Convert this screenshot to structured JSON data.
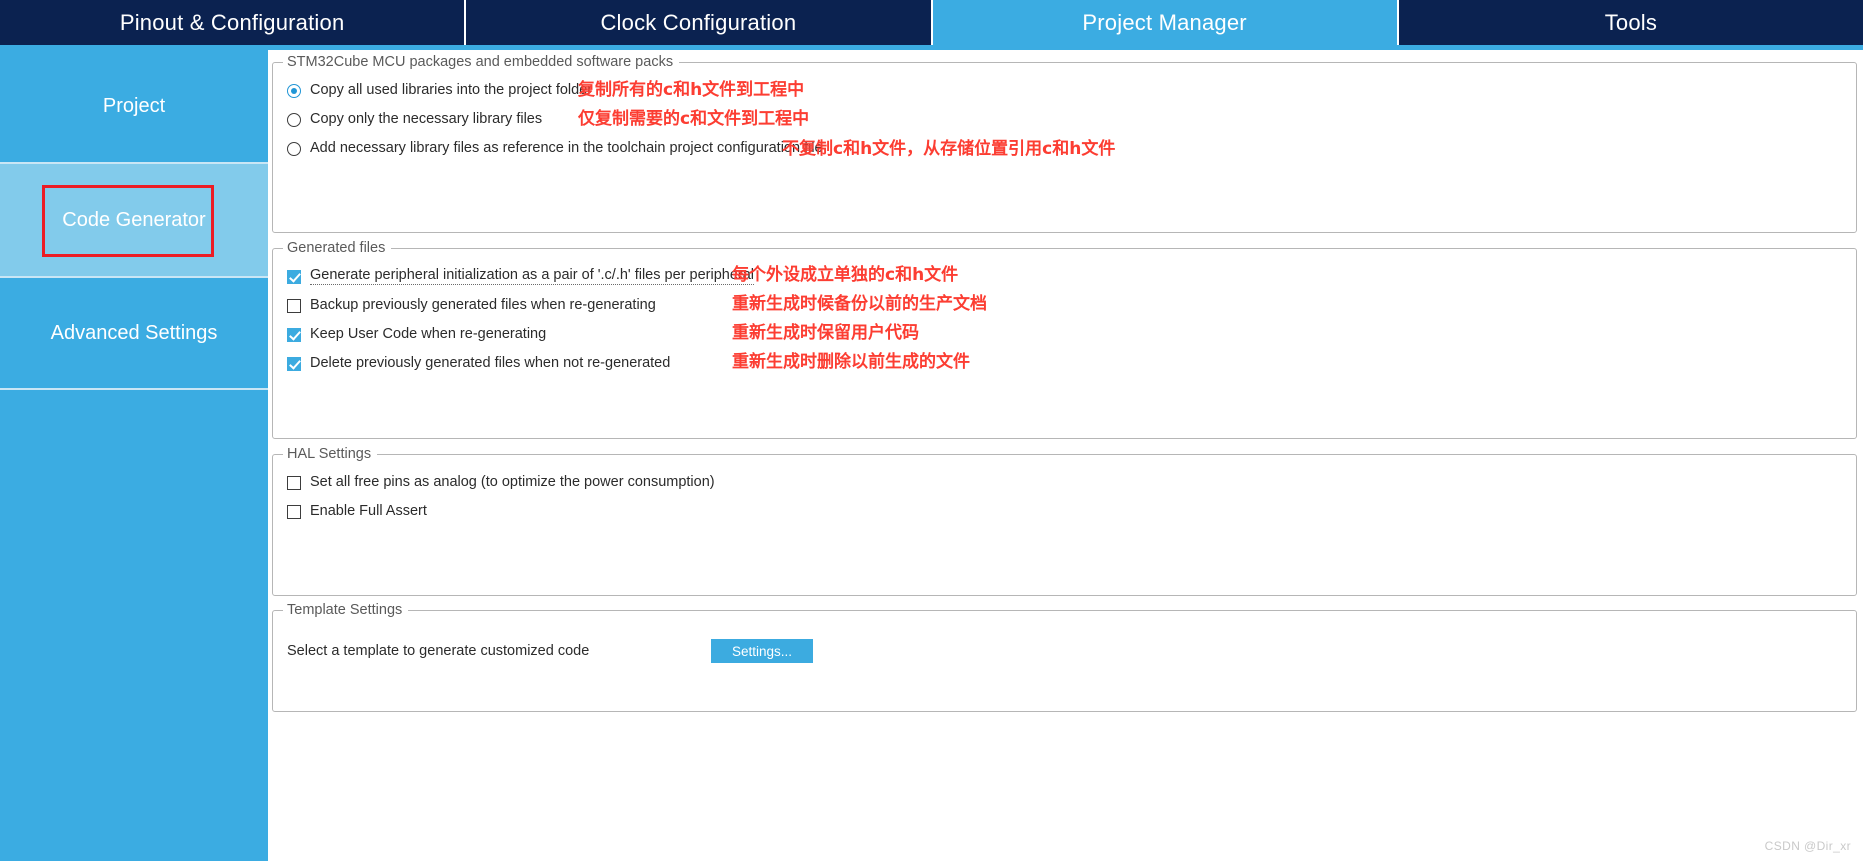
{
  "tabs": [
    {
      "label": "Pinout & Configuration",
      "active": false
    },
    {
      "label": "Clock Configuration",
      "active": false
    },
    {
      "label": "Project Manager",
      "active": true
    },
    {
      "label": "Tools",
      "active": false
    }
  ],
  "sidebar": {
    "items": [
      {
        "label": "Project"
      },
      {
        "label": "Code Generator"
      },
      {
        "label": "Advanced Settings"
      }
    ]
  },
  "groups": {
    "packages": {
      "title": "STM32Cube MCU packages and embedded software packs",
      "options": [
        {
          "label": "Copy all used libraries into the project folder",
          "selected": true,
          "annotation": "复制所有的c和h文件到工程中"
        },
        {
          "label": "Copy only the necessary library files",
          "selected": false,
          "annotation": "仅复制需要的c和文件到工程中"
        },
        {
          "label": "Add necessary library files as reference in the toolchain project configuration file",
          "selected": false,
          "annotation": "不复制c和h文件，从存储位置引用c和h文件"
        }
      ]
    },
    "generated": {
      "title": "Generated files",
      "options": [
        {
          "label": "Generate peripheral initialization as a pair of '.c/.h' files per peripheral",
          "checked": true,
          "annotation": "每个外设成立单独的c和h文件"
        },
        {
          "label": "Backup previously generated files when re-generating",
          "checked": false,
          "annotation": "重新生成时候备份以前的生产文档"
        },
        {
          "label": "Keep User Code when re-generating",
          "checked": true,
          "annotation": "重新生成时保留用户代码"
        },
        {
          "label": "Delete previously generated files when not re-generated",
          "checked": true,
          "annotation": "重新生成时删除以前生成的文件"
        }
      ]
    },
    "hal": {
      "title": "HAL Settings",
      "options": [
        {
          "label": "Set all free pins as analog (to optimize the power consumption)",
          "checked": false
        },
        {
          "label": "Enable Full Assert",
          "checked": false
        }
      ]
    },
    "template": {
      "title": "Template Settings",
      "description": "Select a template to generate customized code",
      "button_label": "Settings..."
    }
  },
  "watermark": "CSDN @Dir_xr",
  "colors": {
    "tab_inactive": "#0b2250",
    "tab_active": "#3bace2",
    "sidebar": "#3bace2",
    "sidebar_selected": "#82cbeb",
    "annotation_red": "#fc3d32",
    "highlight_box": "#ec1c24",
    "accent_button": "#3cabe0"
  }
}
